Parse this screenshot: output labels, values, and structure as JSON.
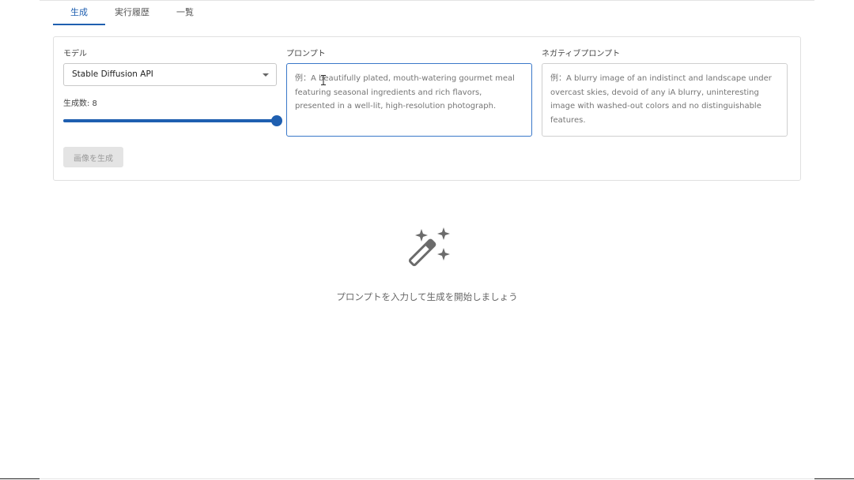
{
  "tabs": [
    {
      "label": "生成",
      "active": true
    },
    {
      "label": "実行履歴",
      "active": false
    },
    {
      "label": "一覧",
      "active": false
    }
  ],
  "form": {
    "model": {
      "label": "モデル",
      "selected": "Stable Diffusion API"
    },
    "count": {
      "label": "生成数: 8",
      "value": 8,
      "fraction": 1.0
    },
    "prompt": {
      "label": "プロンプト",
      "placeholder": "例：A beautifully plated, mouth-watering gourmet meal featuring seasonal ingredients and rich flavors, presented in a well-lit, high-resolution photograph.",
      "value": ""
    },
    "negative_prompt": {
      "label": "ネガティブプロンプト",
      "placeholder": "例：A blurry image of an indistinct and landscape under overcast skies, devoid of any iA blurry, uninteresting image with washed-out colors and no distinguishable features.",
      "value": ""
    },
    "generate_button": {
      "label": "画像を生成",
      "disabled": true
    }
  },
  "empty_state": {
    "icon": "magic-wand-sparkles-icon",
    "message": "プロンプトを入力して生成を開始しましょう"
  },
  "colors": {
    "accent": "#1f5fb0",
    "track": "#bcd3ef",
    "icon": "#6b6b6b"
  }
}
